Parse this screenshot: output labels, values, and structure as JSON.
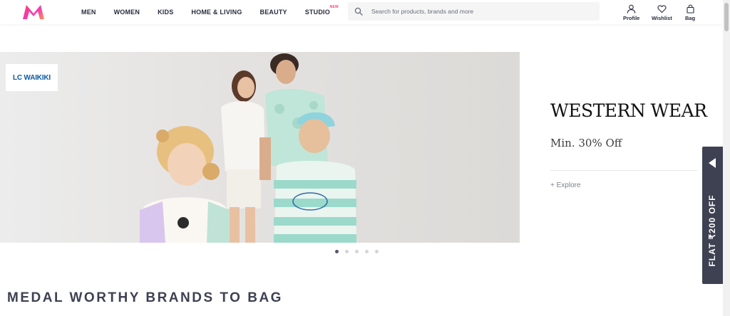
{
  "header": {
    "logo": "myntra-logo",
    "nav": [
      "MEN",
      "WOMEN",
      "KIDS",
      "HOME & LIVING",
      "BEAUTY",
      "STUDIO"
    ],
    "studio_badge": "NEW",
    "search_placeholder": "Search for products, brands and more",
    "actions": {
      "profile": "Profile",
      "wishlist": "Wishlist",
      "bag": "Bag"
    }
  },
  "banner": {
    "brand": "LC WAIKIKI",
    "title": "WESTERN WEAR",
    "subtitle": "Min. 30% Off",
    "cta": "+ Explore",
    "slides": 5,
    "active_slide": 1
  },
  "side_promo": {
    "text": "FLAT ₹200 OFF"
  },
  "section": {
    "title": "MEDAL WORTHY BRANDS TO BAG"
  },
  "colors": {
    "accent": "#ff3f6c",
    "dark": "#3e4152",
    "text": "#282c3f"
  }
}
